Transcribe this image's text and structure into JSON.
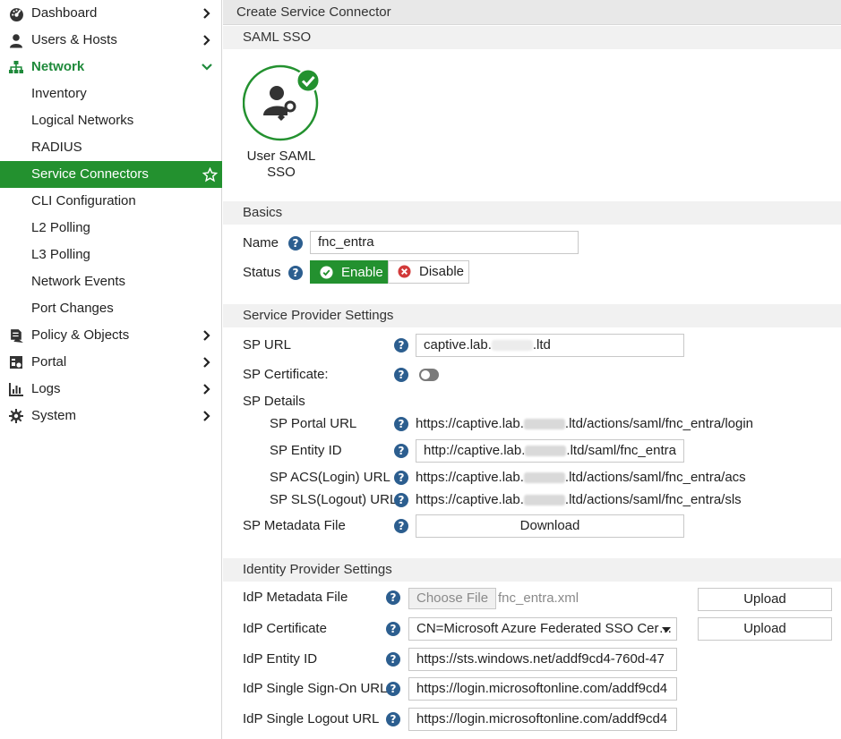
{
  "sidebar": {
    "items": [
      {
        "label": "Dashboard"
      },
      {
        "label": "Users & Hosts"
      },
      {
        "label": "Network"
      },
      {
        "label": "Inventory"
      },
      {
        "label": "Logical Networks"
      },
      {
        "label": "RADIUS"
      },
      {
        "label": "Service Connectors"
      },
      {
        "label": "CLI Configuration"
      },
      {
        "label": "L2 Polling"
      },
      {
        "label": "L3 Polling"
      },
      {
        "label": "Network Events"
      },
      {
        "label": "Port Changes"
      },
      {
        "label": "Policy & Objects"
      },
      {
        "label": "Portal"
      },
      {
        "label": "Logs"
      },
      {
        "label": "System"
      }
    ],
    "accent_color": "#23912f"
  },
  "main": {
    "title": "Create Service Connector",
    "saml_section": "SAML SSO",
    "connector_tile_label": "User SAML SSO",
    "basics": {
      "header": "Basics",
      "name_label": "Name",
      "name_value": "fnc_entra",
      "status_label": "Status",
      "enable_label": "Enable",
      "disable_label": "Disable"
    },
    "sp": {
      "header": "Service Provider Settings",
      "url_label": "SP URL",
      "url_prefix": "captive.lab.",
      "url_suffix": ".ltd",
      "cert_label": "SP Certificate:",
      "details_label": "SP Details",
      "portal_url_label": "SP Portal URL",
      "portal_url_prefix": "https://captive.lab.",
      "portal_url_suffix": ".ltd/actions/saml/fnc_entra/login",
      "entity_id_label": "SP Entity ID",
      "entity_id_prefix": "http://captive.lab.",
      "entity_id_suffix": ".ltd/saml/fnc_entra",
      "acs_label": "SP ACS(Login) URL",
      "acs_prefix": "https://captive.lab.",
      "acs_suffix": ".ltd/actions/saml/fnc_entra/acs",
      "sls_label": "SP SLS(Logout) URL",
      "sls_prefix": "https://captive.lab.",
      "sls_suffix": ".ltd/actions/saml/fnc_entra/sls",
      "metadata_label": "SP Metadata File",
      "download_label": "Download"
    },
    "idp": {
      "header": "Identity Provider Settings",
      "metadata_label": "IdP Metadata File",
      "choose_file_label": "Choose File",
      "file_name": "fnc_entra.xml",
      "upload_label": "Upload",
      "cert_label": "IdP Certificate",
      "cert_value": "CN=Microsoft Azure Federated SSO Cer…",
      "upload_label_2": "Upload",
      "entity_id_label": "IdP Entity ID",
      "entity_id_value": "https://sts.windows.net/addf9cd4-760d-47",
      "sso_url_label": "IdP Single Sign-On URL",
      "sso_url_value": "https://login.microsoftonline.com/addf9cd4",
      "slo_url_label": "IdP Single Logout URL",
      "slo_url_value": "https://login.microsoftonline.com/addf9cd4"
    },
    "help_glyph": "?"
  }
}
